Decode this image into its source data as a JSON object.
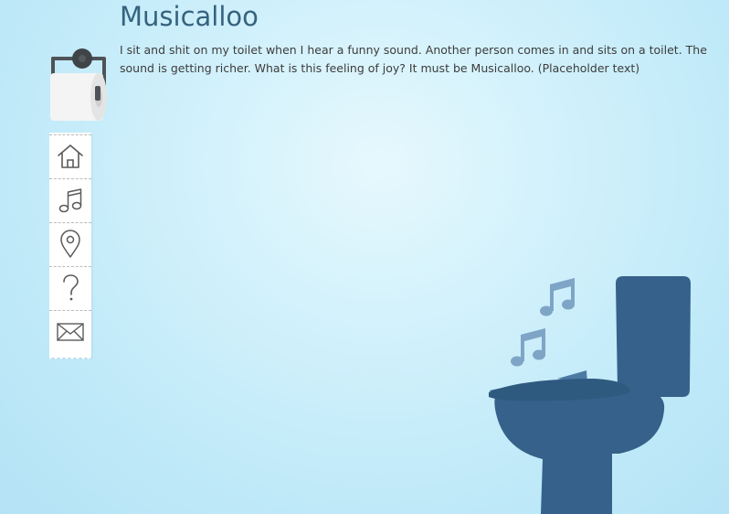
{
  "page": {
    "title": "Musicalloo",
    "intro": "I sit and shit on my toilet when I hear a funny sound. Another person comes in and sits on a toilet. The sound is getting richer. What is this feeling of joy? It must be Musicalloo. (Placeholder text)"
  },
  "nav": {
    "items": [
      {
        "icon": "home-icon"
      },
      {
        "icon": "music-note-icon"
      },
      {
        "icon": "location-pin-icon"
      },
      {
        "icon": "question-icon"
      },
      {
        "icon": "mail-icon"
      }
    ]
  },
  "colors": {
    "title": "#35637e",
    "toilet": "#35618a",
    "notes": "#7fa5c6",
    "nav_icon_stroke": "#5a5a5a"
  }
}
